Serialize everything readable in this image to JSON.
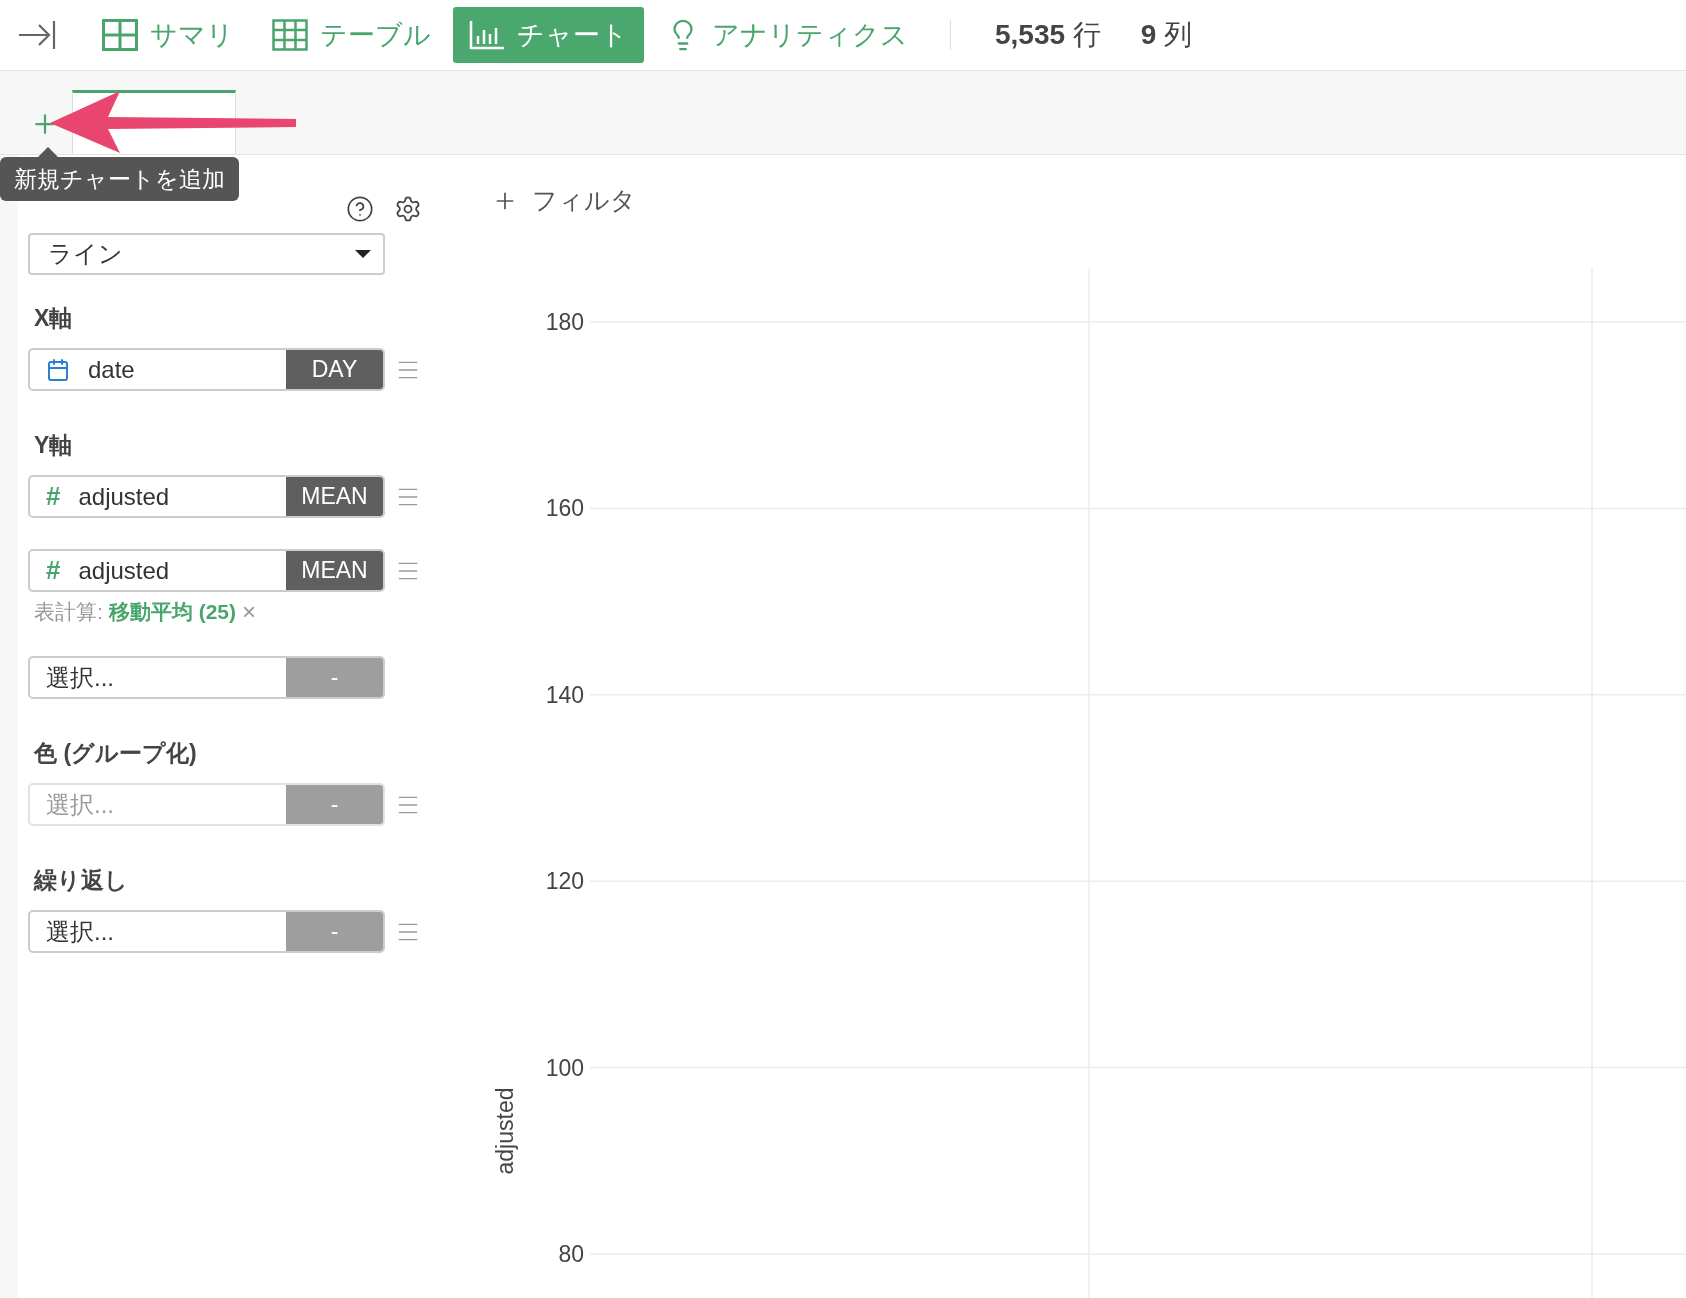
{
  "toolbar": {
    "nav_tabs": [
      {
        "kind": "summary",
        "label": "サマリ",
        "selected": false
      },
      {
        "kind": "table",
        "label": "テーブル",
        "selected": false
      },
      {
        "kind": "chart",
        "label": "チャート",
        "selected": true
      },
      {
        "kind": "analytics",
        "label": "アナリティクス",
        "selected": false
      }
    ],
    "stats": [
      {
        "value": "5,535",
        "unit": "行"
      },
      {
        "value": "9",
        "unit": "列"
      }
    ]
  },
  "chart_tabs": {
    "tooltip": "新規チャートを追加"
  },
  "panel": {
    "chart_type": "ライン",
    "sections": [
      {
        "label": "X軸",
        "fields": [
          {
            "kind": "date",
            "value": "date",
            "aggregation": "DAY",
            "draggable": true
          }
        ]
      },
      {
        "label": "Y軸",
        "fields": [
          {
            "kind": "number",
            "symbol": "#",
            "value": "adjusted",
            "aggregation": "MEAN",
            "draggable": true
          },
          {
            "kind": "number",
            "symbol": "#",
            "value": "adjusted",
            "aggregation": "MEAN",
            "draggable": true,
            "calc": {
              "prefix": "表計算:",
              "name": "移動平均 (25)",
              "remove": "×"
            }
          },
          {
            "kind": "empty",
            "value": "選択...",
            "aggregation": "-",
            "draggable": false
          }
        ]
      },
      {
        "label": "色 (グループ化)",
        "fields": [
          {
            "kind": "empty",
            "placeholder": "選択...",
            "aggregation": "-",
            "draggable": true
          }
        ]
      },
      {
        "label": "繰り返し",
        "fields": [
          {
            "kind": "empty",
            "value": "選択...",
            "aggregation": "-",
            "draggable": true
          }
        ]
      }
    ]
  },
  "filter": {
    "label": "フィルタ"
  },
  "chart": {
    "y_axis": {
      "title": "adjusted",
      "ticks": [
        "180",
        "160",
        "140",
        "120",
        "100",
        "80"
      ]
    }
  }
}
